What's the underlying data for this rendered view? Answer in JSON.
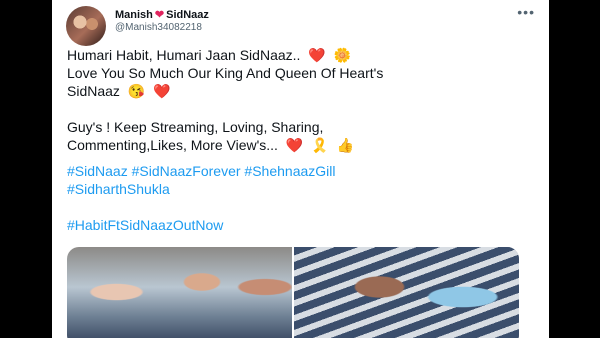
{
  "tweet": {
    "author_name_part1": "Manish",
    "author_name_heart": "❤",
    "author_name_part2": "SidNaaz",
    "handle": "@Manish34082218",
    "more_label": "•••",
    "lines": [
      {
        "text": "Humari Habit, Humari Jaan SidNaaz..",
        "emojis": [
          "❤️",
          "🌼"
        ]
      },
      {
        "text": "Love You So Much Our King And Queen Of Heart's",
        "emojis": []
      },
      {
        "text": "SidNaaz",
        "emojis": [
          "😘",
          "❤️"
        ]
      },
      {
        "text": "",
        "emojis": []
      },
      {
        "text": "Guy's ! Keep Streaming, Loving, Sharing,",
        "emojis": []
      },
      {
        "text": "Commenting,Likes, More View's...",
        "emojis": [
          "❤️",
          "🎗️",
          "👍"
        ]
      }
    ],
    "hashtags_line1": [
      "#SidNaaz",
      "#SidNaazForever",
      "#ShehnaazGill"
    ],
    "hashtags_line2": [
      "#SidharthShukla"
    ],
    "hashtag_line3": "#HabitFtSidNaazOutNow"
  }
}
